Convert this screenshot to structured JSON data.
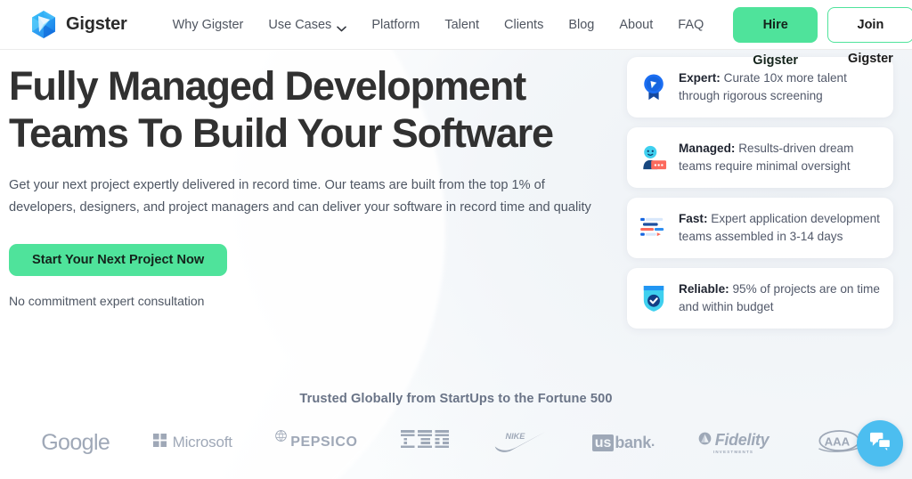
{
  "brand": {
    "name": "Gigster",
    "logo_icon": "gigster-gem-logo"
  },
  "nav": {
    "items": [
      {
        "label": "Why Gigster",
        "has_dropdown": false
      },
      {
        "label": "Use Cases",
        "has_dropdown": true
      },
      {
        "label": "Platform",
        "has_dropdown": false
      },
      {
        "label": "Talent",
        "has_dropdown": false
      },
      {
        "label": "Clients",
        "has_dropdown": false
      },
      {
        "label": "Blog",
        "has_dropdown": false
      },
      {
        "label": "About",
        "has_dropdown": false
      },
      {
        "label": "FAQ",
        "has_dropdown": false
      }
    ],
    "hire_button": "Hire Gigster",
    "join_button": "Join Gigster"
  },
  "hero": {
    "title_line1": "Fully Managed Development",
    "title_line2": "Teams To Build Your Software",
    "subtitle": "Get your next project expertly delivered in record time. Our teams are built from the top 1% of developers, designers, and project managers and can deliver your software in record time and quality",
    "cta_label": "Start Your Next Project Now",
    "note": "No commitment expert consultation"
  },
  "cards": [
    {
      "icon": "award-badge-icon",
      "label": "Expert:",
      "text": " Curate 10x more talent through rigorous screening"
    },
    {
      "icon": "person-chat-icon",
      "label": "Managed:",
      "text": " Results-driven dream teams require minimal oversight"
    },
    {
      "icon": "gantt-chart-icon",
      "label": "Fast:",
      "text": " Expert application development teams assembled in 3-14 days"
    },
    {
      "icon": "shield-check-icon",
      "label": "Reliable:",
      "text": " 95% of projects are on time and within budget"
    }
  ],
  "trusted": {
    "title": "Trusted Globally from StartUps to the Fortune 500",
    "logos": [
      {
        "name": "Google",
        "text": "Google"
      },
      {
        "name": "Microsoft",
        "text": "Microsoft"
      },
      {
        "name": "PepsiCo",
        "text": "PEPSICO"
      },
      {
        "name": "IBM",
        "text": "IBM"
      },
      {
        "name": "Nike",
        "text": "NIKE"
      },
      {
        "name": "US Bank",
        "text": "usbank"
      },
      {
        "name": "Fidelity Investments",
        "text": "Fidelity",
        "sub": "INVESTMENTS"
      },
      {
        "name": "AAA",
        "text": "AAA"
      }
    ],
    "logos_row2": [
      {
        "name": "partial-logo-1",
        "text": ""
      },
      {
        "name": "partial-logo-2",
        "text": ""
      },
      {
        "name": "partial-logo-3",
        "text": ""
      }
    ]
  },
  "chat": {
    "icon": "chat-bubbles-icon",
    "tooltip": "Chat"
  },
  "colors": {
    "accent_green": "#4fe39b",
    "brand_blue": "#2196f3",
    "chat_blue": "#4cbef0",
    "text_dark": "#313131",
    "text_muted": "#4e5663",
    "logo_gray": "#9aa4b4"
  }
}
